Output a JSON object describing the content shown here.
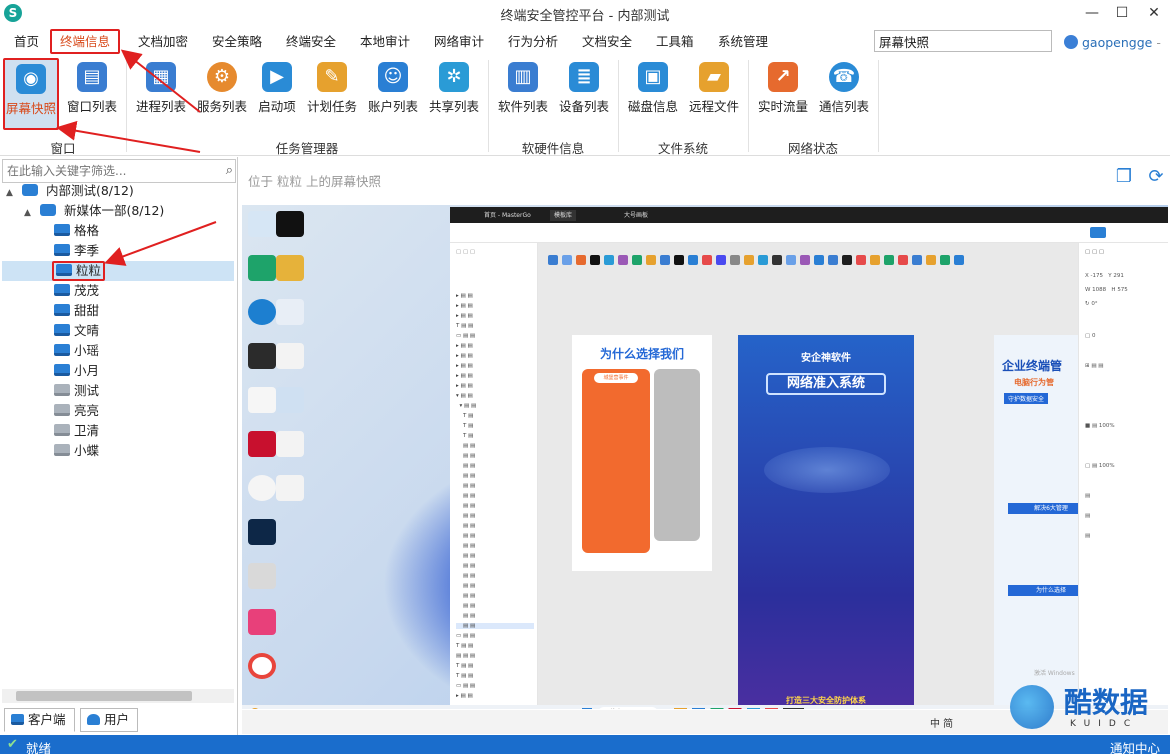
{
  "window": {
    "title": "终端安全管控平台 - 内部测试",
    "minimize": "—",
    "maximize": "☐",
    "close": "✕"
  },
  "menu": {
    "items": [
      "首页",
      "终端信息",
      "文档加密",
      "安全策略",
      "终端安全",
      "本地审计",
      "网络审计",
      "行为分析",
      "文档安全",
      "工具箱",
      "系统管理"
    ],
    "active_index": 1,
    "search_value": "屏幕快照",
    "user": "gaopengge",
    "user_caret": "-"
  },
  "ribbon": {
    "groups": [
      {
        "label": "窗口",
        "buttons": [
          {
            "label": "屏幕快照",
            "icon": "camera-icon",
            "color": "#2a8bd6"
          },
          {
            "label": "窗口列表",
            "icon": "window-list-icon",
            "color": "#3a7dd1"
          }
        ]
      },
      {
        "label": "任务管理器",
        "buttons": [
          {
            "label": "进程列表",
            "icon": "process-list-icon",
            "color": "#3a7dd1"
          },
          {
            "label": "服务列表",
            "icon": "service-list-icon",
            "color": "#e68a2e"
          },
          {
            "label": "启动项",
            "icon": "startup-icon",
            "color": "#2a8bd6"
          },
          {
            "label": "计划任务",
            "icon": "scheduled-task-icon",
            "color": "#e6a12e"
          },
          {
            "label": "账户列表",
            "icon": "account-list-icon",
            "color": "#2a7fd4"
          },
          {
            "label": "共享列表",
            "icon": "share-list-icon",
            "color": "#2a9bd6"
          }
        ]
      },
      {
        "label": "软硬件信息",
        "buttons": [
          {
            "label": "软件列表",
            "icon": "software-list-icon",
            "color": "#3a7dd1"
          },
          {
            "label": "设备列表",
            "icon": "device-list-icon",
            "color": "#2a8bd6"
          }
        ]
      },
      {
        "label": "文件系统",
        "buttons": [
          {
            "label": "磁盘信息",
            "icon": "disk-info-icon",
            "color": "#2a8bd6"
          },
          {
            "label": "远程文件",
            "icon": "remote-file-icon",
            "color": "#e6a12e"
          }
        ]
      },
      {
        "label": "网络状态",
        "buttons": [
          {
            "label": "实时流量",
            "icon": "traffic-icon",
            "color": "#e66a2e"
          },
          {
            "label": "通信列表",
            "icon": "phone-icon",
            "color": "#2a8bd6"
          }
        ]
      }
    ]
  },
  "tree": {
    "filter_placeholder": "在此输入关键字筛选...",
    "root": {
      "label": "内部测试(8/12)",
      "toggle": "▲"
    },
    "group": {
      "label": "新媒体一部(8/12)",
      "toggle": "▲"
    },
    "terminals": [
      {
        "name": "格格",
        "online": true
      },
      {
        "name": "李季",
        "online": true
      },
      {
        "name": "粒粒",
        "online": true,
        "selected": true
      },
      {
        "name": "茂茂",
        "online": true
      },
      {
        "name": "甜甜",
        "online": true
      },
      {
        "name": "文晴",
        "online": true
      },
      {
        "name": "小瑶",
        "online": true
      },
      {
        "name": "小月",
        "online": true
      },
      {
        "name": "测试",
        "online": false
      },
      {
        "name": "亮亮",
        "online": false
      },
      {
        "name": "卫清",
        "online": false
      },
      {
        "name": "小蝶",
        "online": false
      }
    ]
  },
  "bottom_tabs": {
    "client": "客户端",
    "user": "用户"
  },
  "viewer": {
    "path_text": "位于 粒粒 上的屏幕快照",
    "snapshot": {
      "tabs": [
        "首页 - MasterGo",
        "模板库",
        "大号画板"
      ],
      "card_a_title": "为什么选择我们",
      "card_b_brand": "安企神软件",
      "card_b_title": "网络准入系统",
      "card_c_title": "企业终端管",
      "card_c_sub": "电脑行为管",
      "card_c_sub2": "守护数据安全",
      "card_c_sec1": "解决6大管理",
      "card_c_sec2": "为什么选择",
      "card_b_footer": "打造三大安全防护体系",
      "card_a_badge": "城堡营事件",
      "search_placeholder": "搜索",
      "ime": "中 简",
      "activate": "激活 Windows"
    }
  },
  "watermark": {
    "text": "酷数据",
    "sub": "KUIDC"
  },
  "status": {
    "text": "就绪",
    "check": "✔",
    "notify": "通知中心"
  }
}
